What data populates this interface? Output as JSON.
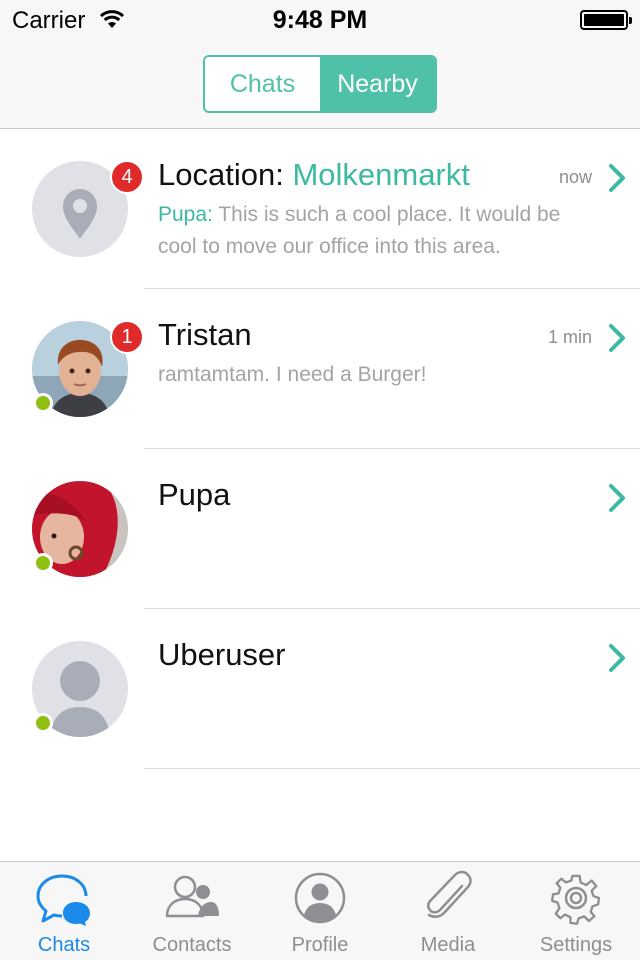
{
  "status_bar": {
    "carrier": "Carrier",
    "time": "9:48 PM"
  },
  "segment": {
    "items": [
      "Chats",
      "Nearby"
    ],
    "selected": "Nearby"
  },
  "chats": [
    {
      "title_prefix": "Location: ",
      "title_highlight": "Molkenmarkt",
      "time": "now",
      "badge": "4",
      "preview_sender": "Pupa:",
      "preview_text": " This is such a cool place. It would be cool to move our office into this area.",
      "avatar": "location-pin"
    },
    {
      "title": "Tristan",
      "time": "1 min",
      "badge": "1",
      "preview_text": "ramtamtam. I need a Burger!",
      "online": true,
      "avatar": "photo-boy"
    },
    {
      "title": "Pupa",
      "online": true,
      "avatar": "photo-red-hair"
    },
    {
      "title": "Uberuser",
      "online": true,
      "avatar": "default-user"
    }
  ],
  "tabbar": {
    "items": [
      {
        "label": "Chats",
        "icon": "chat-bubbles-icon",
        "selected": true
      },
      {
        "label": "Contacts",
        "icon": "contacts-icon"
      },
      {
        "label": "Profile",
        "icon": "profile-icon"
      },
      {
        "label": "Media",
        "icon": "paperclip-icon"
      },
      {
        "label": "Settings",
        "icon": "gear-icon"
      }
    ]
  },
  "colors": {
    "accent": "#4fc1a9",
    "badge": "#e02a2a",
    "online": "#8fbf0f",
    "tab_selected": "#1b8ae8"
  }
}
